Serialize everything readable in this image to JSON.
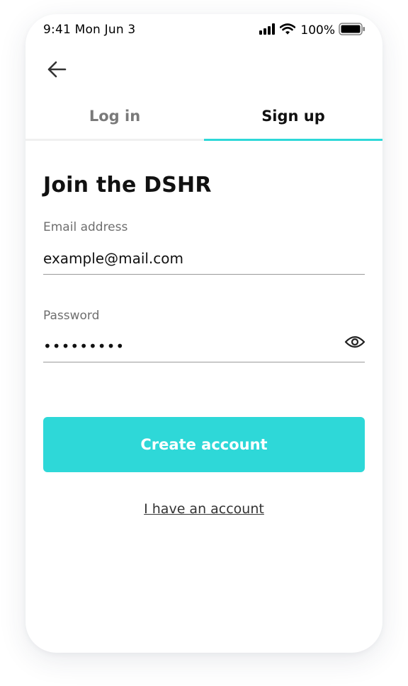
{
  "status_bar": {
    "time": "9:41  Mon Jun 3",
    "battery_percent": "100%",
    "icons": [
      "signal-icon",
      "wifi-icon",
      "battery-icon"
    ]
  },
  "nav": {
    "back_icon": "arrow-left-icon"
  },
  "tabs": [
    {
      "label": "Log in",
      "active": false
    },
    {
      "label": "Sign up",
      "active": true
    }
  ],
  "main": {
    "title": "Join the DSHR"
  },
  "form": {
    "email": {
      "label": "Email address",
      "value": "example@mail.com"
    },
    "password": {
      "label": "Password",
      "value": "•••••••••",
      "toggle_icon": "eye-icon"
    },
    "submit_label": "Create account",
    "secondary_link": "I have an account"
  },
  "colors": {
    "accent": "#2ed8d8",
    "text": "#111111",
    "muted": "#6e6e6e"
  }
}
